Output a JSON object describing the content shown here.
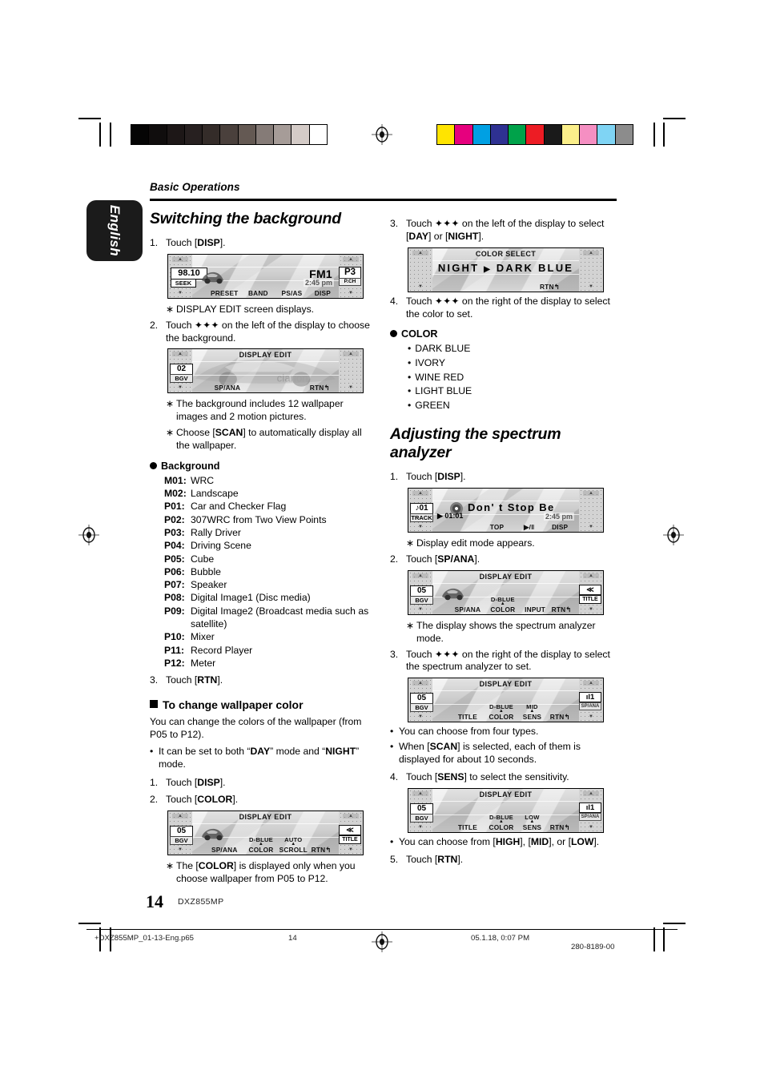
{
  "meta": {
    "running_head": "Basic Operations",
    "language_tab": "English",
    "page_number": "14",
    "model": "DXZ855MP"
  },
  "footer": {
    "file": "+DXZ855MP_01-13-Eng.p65",
    "page": "14",
    "datetime": "05.1.18, 0:07 PM",
    "docnum": "280-8189-00"
  },
  "color_bars": {
    "grayscale": [
      "#050505",
      "#100d0d",
      "#1d1717",
      "#272020",
      "#342c29",
      "#4a403c",
      "#645953",
      "#857b77",
      "#a69c98",
      "#d4cbc7",
      "#ffffff"
    ],
    "process": [
      "#ffe400",
      "#e6007e",
      "#00a0e3",
      "#2e3192",
      "#00a24a",
      "#ed1c24",
      "#1a1a1a",
      "#fbef8a",
      "#f58fc2",
      "#7fd4f4",
      "#8c8c8c"
    ]
  },
  "left_column": {
    "heading": "Switching the background",
    "step1": {
      "num": "1.",
      "text_pre": "Touch [",
      "bold": "DISP",
      "text_post": "]."
    },
    "lcd_radio": {
      "freq": "98.10",
      "seek": "SEEK",
      "band": "FM1",
      "preset_chip": "P3",
      "pch": "P.CH",
      "clock": "2:45 pm",
      "softkeys": [
        "PRESET",
        "BAND",
        "PS/AS",
        "DISP"
      ]
    },
    "note1": {
      "mark": "∗",
      "text": "DISPLAY EDIT screen displays."
    },
    "step2": {
      "num": "2.",
      "text": "Touch ✦✦✦ on the left of the display to choose the background."
    },
    "lcd_display_edit_1": {
      "title": "DISPLAY EDIT",
      "bgv_num": "02",
      "bgv_lbl": "BGV",
      "softkeys": [
        "SP/ANA",
        "RTN"
      ]
    },
    "note2": {
      "mark": "∗",
      "text": "The background includes 12 wallpaper images and 2 motion pictures."
    },
    "note3": {
      "mark": "∗",
      "text_pre": "Choose [",
      "bold": "SCAN",
      "text_post": "] to automatically display all the wallpaper."
    },
    "background_heading": "Background",
    "background_list": [
      {
        "key": "M01",
        "value": "WRC"
      },
      {
        "key": "M02",
        "value": "Landscape"
      },
      {
        "key": "P01",
        "value": "Car and Checker Flag"
      },
      {
        "key": "P02",
        "value": "307WRC from Two View Points"
      },
      {
        "key": "P03",
        "value": "Rally Driver"
      },
      {
        "key": "P04",
        "value": "Driving Scene"
      },
      {
        "key": "P05",
        "value": "Cube"
      },
      {
        "key": "P06",
        "value": "Bubble"
      },
      {
        "key": "P07",
        "value": "Speaker"
      },
      {
        "key": "P08",
        "value": "Digital Image1 (Disc media)"
      },
      {
        "key": "P09",
        "value": "Digital Image2 (Broadcast media such as satellite)"
      },
      {
        "key": "P10",
        "value": "Mixer"
      },
      {
        "key": "P11",
        "value": "Record Player"
      },
      {
        "key": "P12",
        "value": "Meter"
      }
    ],
    "step3": {
      "num": "3.",
      "text_pre": "Touch [",
      "bold": "RTN",
      "text_post": "]."
    },
    "wallpaper_color_heading": "To change wallpaper color",
    "wallpaper_para": "You can change the colors of the wallpaper (from P05 to P12).",
    "wallpaper_bullet": {
      "mark": "•",
      "text_pre": "It can be set to both “",
      "bold1": "DAY",
      "text_mid": "” mode and “",
      "bold2": "NIGHT",
      "text_post": "” mode."
    },
    "wp_step1": {
      "num": "1.",
      "text_pre": "Touch [",
      "bold": "DISP",
      "text_post": "]."
    },
    "wp_step2": {
      "num": "2.",
      "text_pre": "Touch [",
      "bold": "COLOR",
      "text_post": "]."
    },
    "lcd_display_edit_2": {
      "title": "DISPLAY EDIT",
      "bgv_num": "05",
      "bgv_lbl": "BGV",
      "chip_rt_top": "≪",
      "chip_rt_bot": "TITLE",
      "sup_color": "D-BLUE",
      "sup_scroll": "AUTO",
      "softkeys": [
        "SP/ANA",
        "COLOR",
        "SCROLL",
        "RTN"
      ]
    },
    "note4": {
      "mark": "∗",
      "text_pre": "The [",
      "bold": "COLOR",
      "text_post": "] is displayed only when you choose wallpaper from P05 to P12."
    }
  },
  "right_column": {
    "step3": {
      "num": "3.",
      "text_pre": "Touch ✦✦✦ on the left of the display to select [",
      "bold1": "DAY",
      "text_mid": "] or [",
      "bold2": "NIGHT",
      "text_post": "]."
    },
    "lcd_color_select": {
      "title": "COLOR SELECT",
      "center_left": "NIGHT",
      "center_arrow": "▶",
      "center_right": "DARK BLUE",
      "softkeys": [
        "RTN"
      ]
    },
    "step4": {
      "num": "4.",
      "text": "Touch ✦✦✦ on the right of the display to select the color to set."
    },
    "color_heading": "COLOR",
    "color_list": [
      "DARK BLUE",
      "IVORY",
      "WINE RED",
      "LIGHT BLUE",
      "GREEN"
    ],
    "heading2": "Adjusting the spectrum analyzer",
    "sa_step1": {
      "num": "1.",
      "text_pre": "Touch [",
      "bold": "DISP",
      "text_post": "]."
    },
    "lcd_track": {
      "track_chip": "01",
      "track_lbl": "TRACK",
      "title_text": "Don' t  Stop  Be",
      "elapsed": "▶ 01:01",
      "clock": "2:45 pm",
      "softkeys": [
        "TOP",
        "▶/‖",
        "DISP"
      ]
    },
    "sa_note1": {
      "mark": "∗",
      "text": "Display edit mode appears."
    },
    "sa_step2": {
      "num": "2.",
      "text_pre": "Touch [",
      "bold": "SP/ANA",
      "text_post": "]."
    },
    "lcd_display_edit_3": {
      "title": "DISPLAY EDIT",
      "bgv_num": "05",
      "bgv_lbl": "BGV",
      "chip_rt_top": "≪",
      "chip_rt_bot": "TITLE",
      "sup_color": "D-BLUE",
      "softkeys": [
        "SP/ANA",
        "COLOR",
        "INPUT",
        "RTN"
      ]
    },
    "sa_note2": {
      "mark": "∗",
      "text": "The display shows the spectrum analyzer mode."
    },
    "sa_step3": {
      "num": "3.",
      "text": "Touch ✦✦✦ on the right of the display to select the spectrum analyzer to set."
    },
    "lcd_display_edit_4": {
      "title": "DISPLAY EDIT",
      "bgv_num": "05",
      "bgv_lbl": "BGV",
      "spana_chip": "1",
      "spana_lbl": "SP/ANA",
      "sup_color": "D-BLUE",
      "sup_sens": "MID",
      "softkeys": [
        "TITLE",
        "COLOR",
        "SENS",
        "RTN"
      ]
    },
    "sa_bullet1": {
      "mark": "•",
      "text": "You can choose from four types."
    },
    "sa_bullet2": {
      "mark": "•",
      "text_pre": "When [",
      "bold": "SCAN",
      "text_post": "] is selected, each of them is displayed for about 10 seconds."
    },
    "sa_step4": {
      "num": "4.",
      "text_pre": "Touch [",
      "bold": "SENS",
      "text_post": "] to select the sensitivity."
    },
    "lcd_display_edit_5": {
      "title": "DISPLAY EDIT",
      "bgv_num": "05",
      "bgv_lbl": "BGV",
      "spana_chip": "1",
      "spana_lbl": "SP/ANA",
      "sup_color": "D-BLUE",
      "sup_sens": "LOW",
      "softkeys": [
        "TITLE",
        "COLOR",
        "SENS",
        "RTN"
      ]
    },
    "sa_bullet3": {
      "mark": "•",
      "text_pre": "You can choose from [",
      "bold1": "HIGH",
      "text_mid1": "], [",
      "bold2": "MID",
      "text_mid2": "], or [",
      "bold3": "LOW",
      "text_post": "]."
    },
    "sa_step5": {
      "num": "5.",
      "text_pre": "Touch [",
      "bold": "RTN",
      "text_post": "]."
    }
  }
}
